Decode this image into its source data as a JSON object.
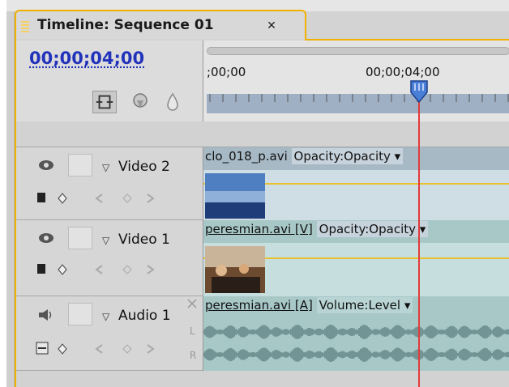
{
  "tab": {
    "title": "Timeline: Sequence 01",
    "close_glyph": "✕"
  },
  "header": {
    "timecode": "00;00;04;00",
    "ruler_labels": [
      ";00;00",
      "00;00;04;00"
    ]
  },
  "tracks": [
    {
      "name": "Video 2",
      "clip_name": "clo_018_p.avi",
      "effect": "Opacity:Opacity",
      "dropdown": "▾",
      "thumbnail": "sky-landscape",
      "clip_color": "#a7b9c5"
    },
    {
      "name": "Video 1",
      "clip_name": "peresmian.avi [V]",
      "effect": "Opacity:Opacity",
      "dropdown": "▾",
      "thumbnail": "indoor-people",
      "clip_color": "#a8c8c8"
    },
    {
      "name": "Audio 1",
      "clip_name": "peresmian.avi [A]",
      "effect": "Volume:Level",
      "dropdown": "▾",
      "channel_labels": [
        "L",
        "R"
      ],
      "clip_color": "#a8c8c8"
    }
  ],
  "colors": {
    "accent": "#f0b000",
    "timecode": "#2233bb",
    "playhead": "#e23b3b",
    "playhead_head": "#4a7fd8"
  },
  "icons": {
    "tab_grip": "grip-icon",
    "snap": "snap-icon",
    "marker": "set-marker-icon",
    "keyframe": "keyframe-icon",
    "eye": "eye-icon",
    "speaker": "speaker-icon",
    "expand": "triangle-down-icon",
    "display_style": "display-style-icon",
    "add_keyframe": "add-keyframe-icon",
    "prev_keyframe": "prev-keyframe-icon",
    "next_keyframe": "next-keyframe-icon"
  }
}
